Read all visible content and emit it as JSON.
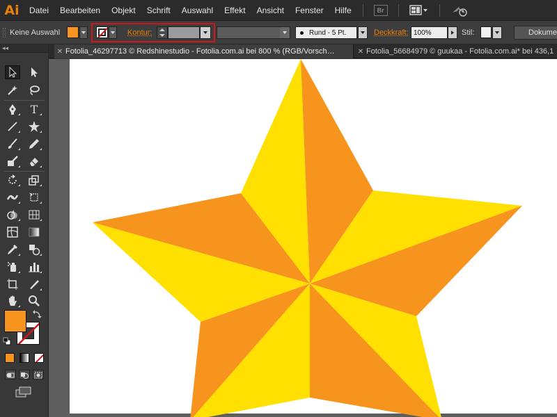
{
  "app": {
    "logo": "Ai",
    "menu": [
      "Datei",
      "Bearbeiten",
      "Objekt",
      "Schrift",
      "Auswahl",
      "Effekt",
      "Ansicht",
      "Fenster",
      "Hilfe"
    ],
    "bridge_button": "Br",
    "icons": [
      "bridge-icon",
      "arrange-documents-icon",
      "sync-icon"
    ]
  },
  "control_bar": {
    "selection_label": "Keine Auswahl",
    "fill_color": "#f7941d",
    "stroke_label": "Kontur:",
    "brush_label": "Rund - 5 Pt.",
    "opacity_label": "Deckkraft:",
    "opacity_value": "100%",
    "style_label": "Stil:",
    "document_button": "Dokumen"
  },
  "panel": {
    "collapse_label": "◂◂"
  },
  "tabs": [
    {
      "label": "Fotolia_46297713 © Redshinestudio - Fotolia.com.ai bei 800 % (RGB/Vorsch…"
    },
    {
      "label": "Fotolia_56684979 © guukaa - Fotolia.com.ai* bei 436,1"
    }
  ],
  "colors": {
    "star_orange": "#f7941d",
    "star_yellow": "#ffe000",
    "highlight_red": "#d0161c",
    "accent_orange": "#e8810c"
  }
}
